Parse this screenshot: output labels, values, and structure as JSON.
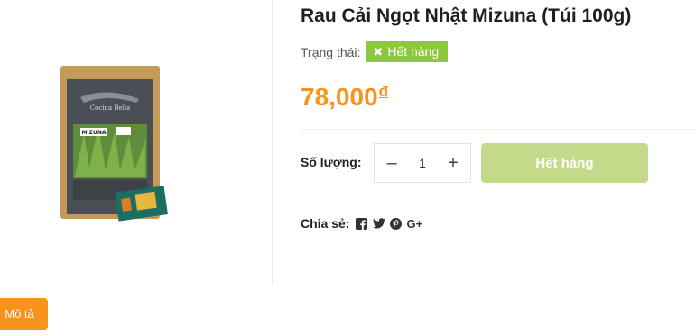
{
  "product": {
    "title": "Rau Cải Ngọt Nhật Mizuna (Túi 100g)",
    "status_label": "Trạng thái:",
    "status_value": "Hết hàng",
    "price": "78,000",
    "currency": "đ",
    "package_brand": "Cocina Bella",
    "package_name": "MIZUNA"
  },
  "purchase": {
    "quantity_label": "Số lượng:",
    "decrement": "–",
    "quantity": "1",
    "increment": "+",
    "buy_button": "Hết hàng"
  },
  "share": {
    "label": "Chia sẻ:",
    "icons": [
      "facebook-icon",
      "twitter-icon",
      "pinterest-icon",
      "google-plus-icon"
    ]
  },
  "tabs": {
    "description": "Mô tả"
  },
  "colors": {
    "accent": "#f7941d",
    "status_badge": "#8dc63f",
    "disabled_button": "#c5d98b"
  }
}
